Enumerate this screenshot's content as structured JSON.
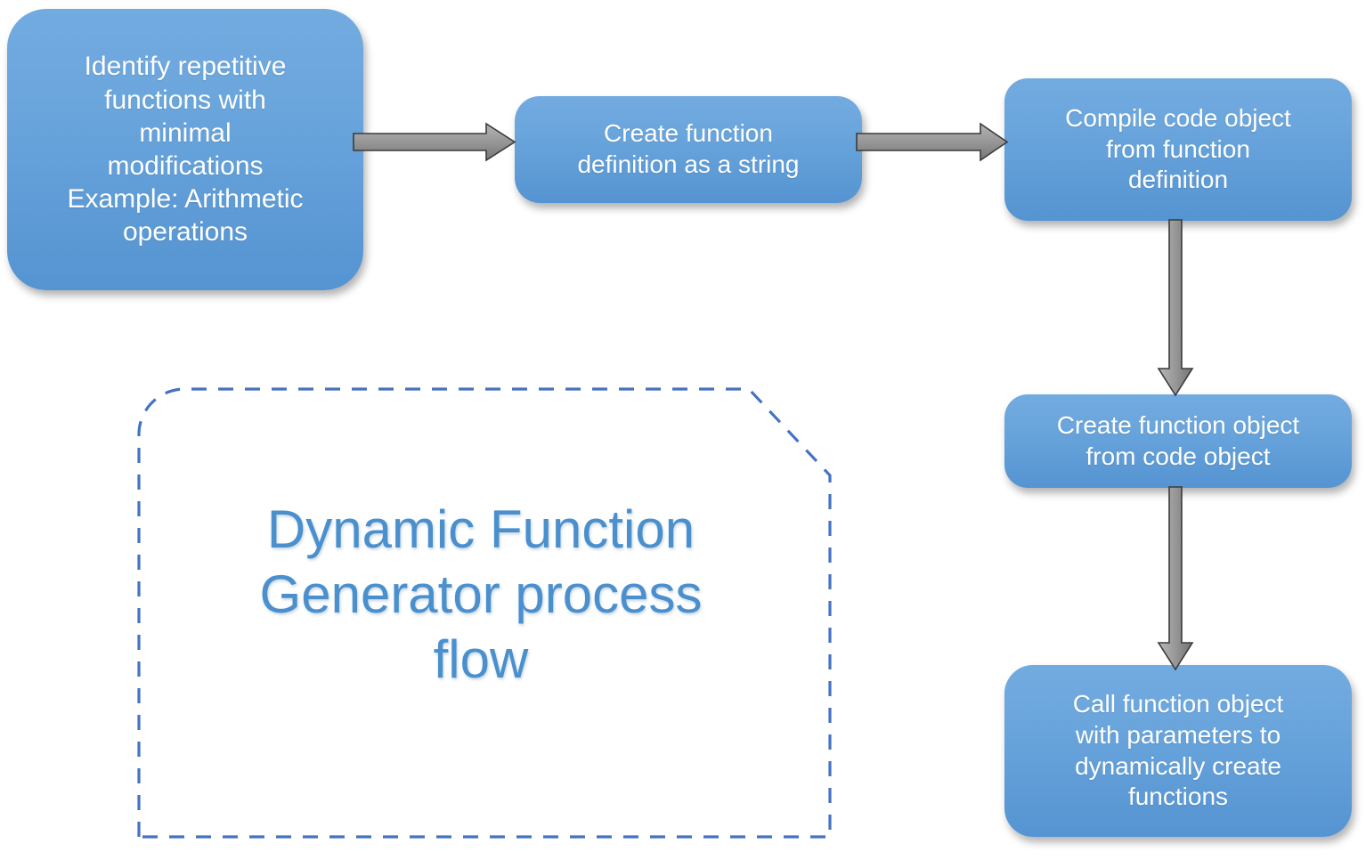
{
  "diagram": {
    "title": "Dynamic Function\nGenerator process\nflow",
    "title_color": "#4A90CE",
    "node_fill_top": "#72ABE0",
    "node_fill_bottom": "#5594D2",
    "node_text_color": "#FFFFFF",
    "arrow_fill": "#9C9C9C",
    "arrow_stroke": "#3B3B3B",
    "dashed_border_color": "#4472C4",
    "background": "#FFFFFF"
  },
  "nodes": [
    {
      "id": "identify",
      "label": "Identify repetitive\nfunctions with\nminimal\nmodifications\nExample: Arithmetic\noperations"
    },
    {
      "id": "create-definition",
      "label": "Create function\ndefinition as a string"
    },
    {
      "id": "compile",
      "label": "Compile code object\nfrom function\ndefinition"
    },
    {
      "id": "create-function-object",
      "label": "Create function object\nfrom code object"
    },
    {
      "id": "call",
      "label": "Call function object\nwith parameters to\ndynamically create\nfunctions"
    }
  ],
  "connectors": [
    {
      "id": "identify-to-create-definition",
      "direction": "right"
    },
    {
      "id": "create-definition-to-compile",
      "direction": "right"
    },
    {
      "id": "compile-to-create-function-object",
      "direction": "down"
    },
    {
      "id": "create-function-object-to-call",
      "direction": "down"
    }
  ]
}
